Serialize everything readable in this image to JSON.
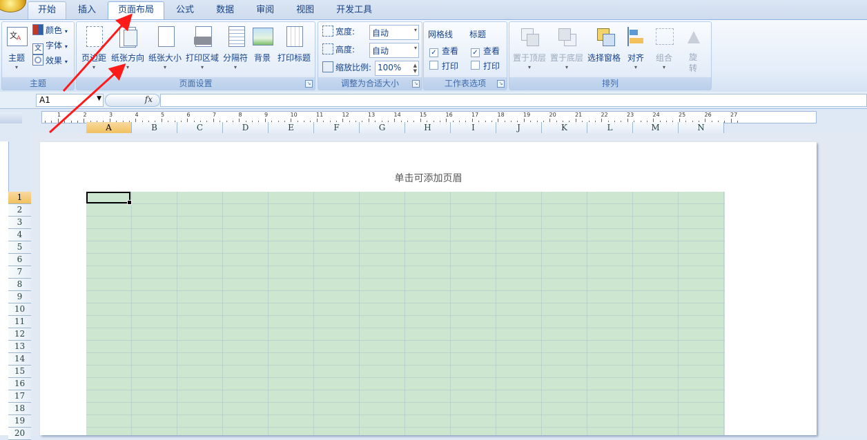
{
  "tabs": [
    "开始",
    "插入",
    "页面布局",
    "公式",
    "数据",
    "审阅",
    "视图",
    "开发工具"
  ],
  "active_tab": "页面布局",
  "ribbon": {
    "theme_group": {
      "label": "主题",
      "theme_btn": "主题",
      "colors": "颜色",
      "fonts": "字体",
      "effects": "效果"
    },
    "page_setup": {
      "label": "页面设置",
      "margins": "页边距",
      "orientation": "纸张方向",
      "size": "纸张大小",
      "print_area": "打印区域",
      "breaks": "分隔符",
      "background": "背景",
      "print_titles": "打印标题"
    },
    "scale_to_fit": {
      "label": "调整为合适大小",
      "width_label": "宽度:",
      "width_value": "自动",
      "height_label": "高度:",
      "height_value": "自动",
      "scale_label": "缩放比例:",
      "scale_value": "100%"
    },
    "sheet_options": {
      "label": "工作表选项",
      "gridlines": "网格线",
      "headings": "标题",
      "view": "查看",
      "print": "打印",
      "gridlines_view": true,
      "gridlines_print": false,
      "headings_view": true,
      "headings_print": false
    },
    "arrange": {
      "label": "排列",
      "bring_forward": "置于顶层",
      "send_backward": "置于底层",
      "selection_pane": "选择窗格",
      "align": "对齐",
      "group": "组合",
      "rotate": "旋转"
    }
  },
  "formula_bar": {
    "name_box": "A1",
    "fx": "fx",
    "formula": ""
  },
  "ruler": {
    "marks": [
      "1",
      "2",
      "3",
      "4",
      "5",
      "6",
      "7",
      "8",
      "9",
      "10",
      "11",
      "12",
      "13",
      "14",
      "15",
      "16",
      "17",
      "18",
      "19",
      "20",
      "21",
      "22",
      "23",
      "24",
      "25",
      "26",
      "27"
    ]
  },
  "columns": [
    "A",
    "B",
    "C",
    "D",
    "E",
    "F",
    "G",
    "H",
    "I",
    "J",
    "K",
    "L",
    "M",
    "N"
  ],
  "rows": [
    "1",
    "2",
    "3",
    "4",
    "5",
    "6",
    "7",
    "8",
    "9",
    "10",
    "11",
    "12",
    "13",
    "14",
    "15",
    "16",
    "17",
    "18",
    "19",
    "20"
  ],
  "selected_cell": {
    "column": "A",
    "row": "1"
  },
  "page": {
    "header_hint": "单击可添加页眉"
  },
  "colors": {
    "annotation_arrow": "#ff1a1a",
    "grid_fill": "#cde6d0",
    "selected_header": "#f1c15f"
  }
}
